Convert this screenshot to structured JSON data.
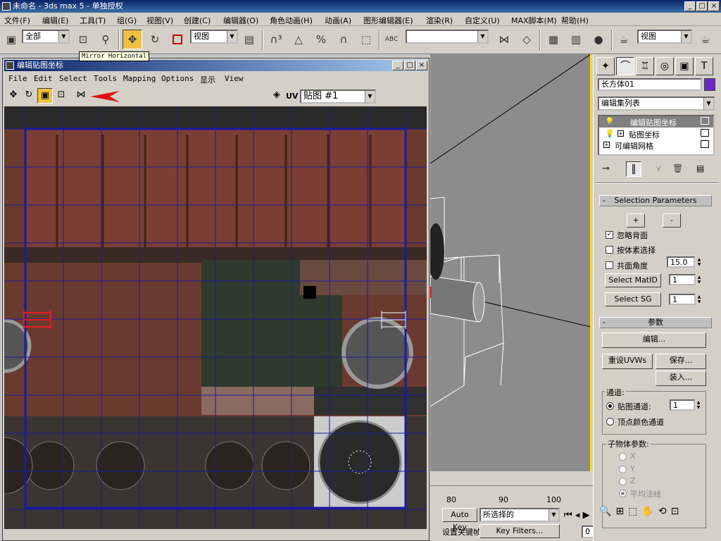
{
  "app": {
    "title": "未命名 - 3ds max 5 - 单独授权",
    "min": "_",
    "max": "□",
    "close": "×"
  },
  "menu": [
    "文件(F)",
    "编辑(E)",
    "工具(T)",
    "组(G)",
    "视图(V)",
    "创建(C)",
    "编辑器(O)",
    "角色动画(H)",
    "动画(A)",
    "图形编辑器(E)",
    "渲染(R)",
    "自定义(U)",
    "MAX脚本(M)",
    "帮助(H)"
  ],
  "toolbar": {
    "selection_filter": "全部",
    "ref_coord": "视图",
    "named_sel": "",
    "view_dropdown": "视图",
    "abc_label": "ABC"
  },
  "uv_editor": {
    "title": "编辑贴图坐标",
    "menu": [
      "File",
      "Edit",
      "Select",
      "Tools",
      "Mapping",
      "Options",
      "显示",
      "View"
    ],
    "uv_label": "UV",
    "map_dropdown": "贴图 #1",
    "tooltip": "Mirror Horizontal",
    "colors": {
      "grid": "#1a1aa0",
      "selected_uv": "#e02020",
      "arrow": "#e01010"
    }
  },
  "command_panel": {
    "object_name": "长方体01",
    "object_color": "#6a28c8",
    "modifier_list": "编辑集列表",
    "stack": [
      "编辑贴图坐标",
      "贴图坐标",
      "可编辑网格"
    ],
    "selection_params": {
      "title": "Selection Parameters",
      "plus": "+",
      "minus": "-",
      "ignore_backface": "忽略背面",
      "select_by_element": "按体素选择",
      "planar_angle": "共面角度",
      "planar_value": "15.0",
      "select_matid": "Select MatID",
      "select_sg": "Select SG",
      "matid_value": "1",
      "sg_value": "1"
    },
    "params": {
      "title": "参数",
      "edit": "编辑...",
      "reset": "重设UVWs",
      "save": "保存...",
      "load": "装入...",
      "channel_group": "通道:",
      "map_channel": "贴图通道:",
      "map_channel_value": "1",
      "vertex_color": "顶点颜色通道",
      "subobj_group": "子物体参数:",
      "x": "X",
      "y": "Y",
      "z": "Z",
      "avg_normals": "平均法线"
    }
  },
  "timeline": {
    "ticks": [
      "80",
      "90",
      "100"
    ],
    "auto_key": "Auto Key",
    "set_key": "设置关键帧",
    "selected": "所选择的",
    "key_filters": "Key Filters...",
    "frame": "0"
  }
}
